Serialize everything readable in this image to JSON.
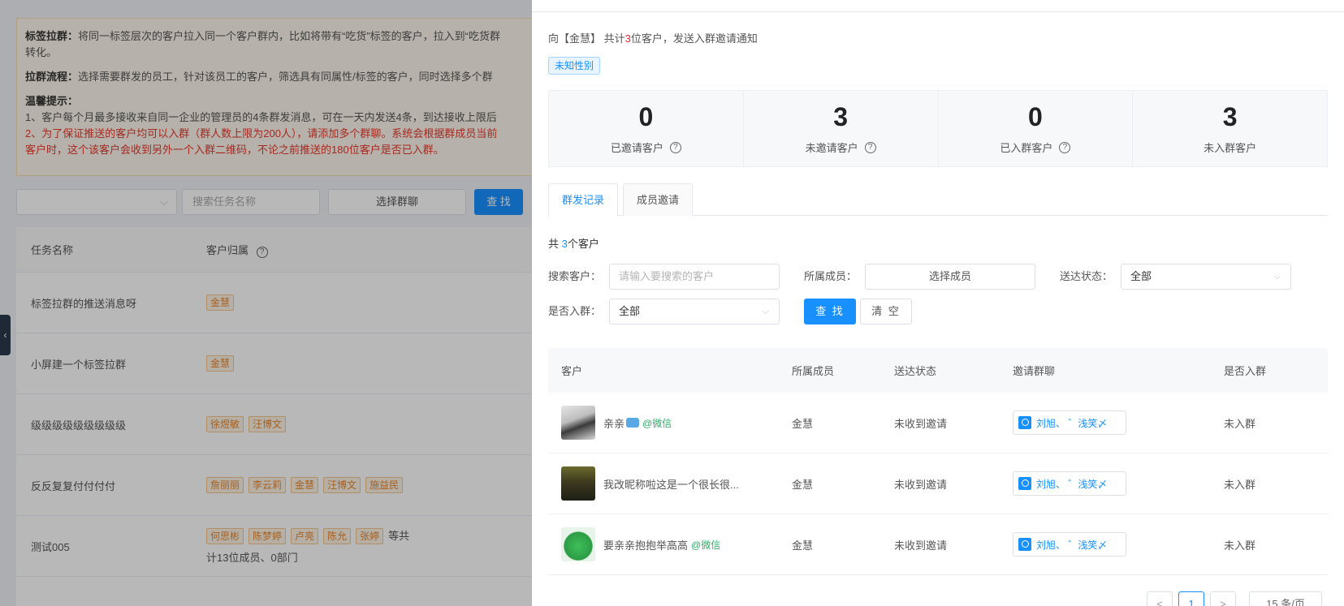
{
  "background": {
    "notice": {
      "line1_bold": "标签拉群：",
      "line1": "将同一标签层次的客户拉入同一个客户群内，比如将带有“吃货”标签的客户，拉入到“吃货群",
      "line1b": "转化。",
      "line2_bold": "拉群流程：",
      "line2": "选择需要群发的员工，针对该员工的客户，筛选具有同属性/标签的客户，同时选择多个群",
      "tips_title": "温馨提示：",
      "tip1": "1、客户每个月最多接收来自同一企业的管理员的4条群发消息，可在一天内发送4条，到达接收上限后",
      "tip2": "2、为了保证推送的客户均可以入群（群人数上限为200人），请添加多个群聊。系统会根据群成员当前",
      "tip3": "客户时，这个该客户会收到另外一个入群二维码，不论之前推送的180位客户是否已入群。"
    },
    "filters": {
      "search_placeholder": "搜索任务名称",
      "select_group_label": "选择群聊",
      "search_button": "查 找"
    },
    "table": {
      "col_task": "任务名称",
      "col_owner": "客户归属",
      "rows": [
        {
          "name": "标签拉群的推送消息呀",
          "tags": [
            "金慧"
          ],
          "extra": ""
        },
        {
          "name": "小屏建一个标签拉群",
          "tags": [
            "金慧"
          ],
          "extra": ""
        },
        {
          "name": "级级级级级级级级级",
          "tags": [
            "徐煜敏",
            "汪博文"
          ],
          "extra": ""
        },
        {
          "name": "反反复复付付付付",
          "tags": [
            "詹丽丽",
            "李云莉",
            "金慧",
            "汪博文",
            "施益民"
          ],
          "extra": ""
        },
        {
          "name": "测试005",
          "tags": [
            "何思彬",
            "陈梦婷",
            "卢亮",
            "陈允",
            "张婷"
          ],
          "extra": "等共",
          "extra2": "计13位成员、0部门"
        }
      ]
    }
  },
  "drawer": {
    "intro": {
      "prefix": "向【金慧】 共计",
      "count": "3",
      "suffix": "位客户，发送入群邀请通知"
    },
    "gender_tag": "未知性别",
    "stats": [
      {
        "value": "0",
        "label": "已邀请客户",
        "help": true
      },
      {
        "value": "3",
        "label": "未邀请客户",
        "help": true
      },
      {
        "value": "0",
        "label": "已入群客户",
        "help": true
      },
      {
        "value": "3",
        "label": "未入群客户",
        "help": false
      }
    ],
    "tabs": [
      "群发记录",
      "成员邀请"
    ],
    "total": {
      "prefix": "共 ",
      "count": "3",
      "suffix": "个客户"
    },
    "filters": {
      "search_label": "搜索客户：",
      "search_placeholder": "请输入要搜索的客户",
      "member_label": "所属成员：",
      "member_button": "选择成员",
      "status_label": "送达状态：",
      "status_value": "全部",
      "joined_label": "是否入群：",
      "joined_value": "全部",
      "find_button": "查 找",
      "clear_button": "清 空"
    },
    "table": {
      "headers": [
        "客户",
        "所属成员",
        "送达状态",
        "邀请群聊",
        "是否入群"
      ],
      "rows": [
        {
          "customer": "亲亲",
          "wechat": "@微信",
          "member": "金慧",
          "status": "未收到邀请",
          "group": "刘旭、 ゛浅笑〆",
          "joined": "未入群"
        },
        {
          "customer": "我改昵称啦这是一个很长很...",
          "wechat": "",
          "member": "金慧",
          "status": "未收到邀请",
          "group": "刘旭、 ゛浅笑〆",
          "joined": "未入群"
        },
        {
          "customer": "要亲亲抱抱举高高",
          "wechat": "@微信",
          "member": "金慧",
          "status": "未收到邀请",
          "group": "刘旭、 ゛浅笑〆",
          "joined": "未入群"
        }
      ]
    },
    "pagination": {
      "prev": "<",
      "current": "1",
      "next": ">",
      "page_size": "15 条/页"
    }
  }
}
